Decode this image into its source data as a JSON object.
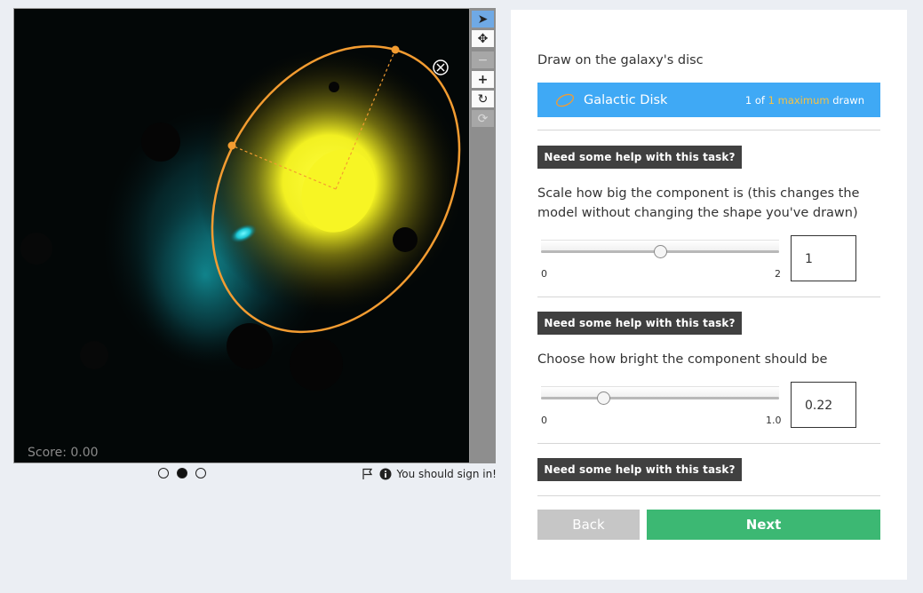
{
  "viewer": {
    "score_text": "Score: 0.00",
    "accent_color": "#f39c31"
  },
  "toolbar": {
    "tools": [
      {
        "icon": "cursor-icon",
        "glyph": "➤",
        "state": "active"
      },
      {
        "icon": "pan-icon",
        "glyph": "✥",
        "state": "normal"
      },
      {
        "icon": "zoom-out-icon",
        "glyph": "−",
        "state": "disabled"
      },
      {
        "icon": "zoom-in-icon",
        "glyph": "+",
        "state": "normal"
      },
      {
        "icon": "rotate-icon",
        "glyph": "↻",
        "state": "normal"
      },
      {
        "icon": "reset-icon",
        "glyph": "⟳",
        "state": "disabled"
      }
    ]
  },
  "pager": {
    "pages": 3,
    "current": 2
  },
  "signin": {
    "text": "You should sign in!"
  },
  "task": {
    "instruction": "Draw on the galaxy's disc",
    "tool_label": "Galactic Disk",
    "count_prefix": "1 of",
    "count_max": "1 maximum",
    "count_suffix": "drawn",
    "tool_color": "#3fa9f5"
  },
  "help_label": "Need some help with this task?",
  "scale": {
    "question": "Scale how big the component is (this changes the model without changing the shape you've drawn)",
    "min": "0",
    "max": "2",
    "value": "1",
    "fraction": 0.5
  },
  "brightness": {
    "question": "Choose how bright the component should be",
    "min": "0",
    "max": "1.0",
    "value": "0.22",
    "fraction": 0.26
  },
  "nav": {
    "back_label": "Back",
    "next_label": "Next",
    "next_color": "#3cb873"
  }
}
